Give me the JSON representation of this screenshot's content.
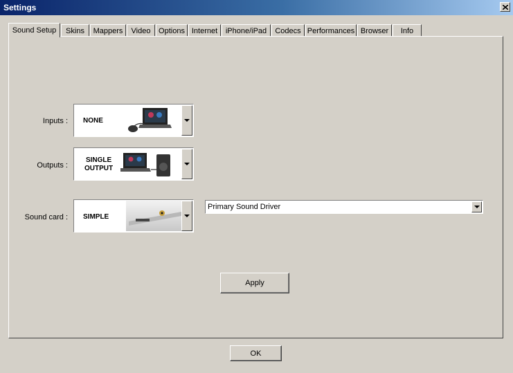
{
  "window": {
    "title": "Settings"
  },
  "tabs": [
    {
      "label": "Sound Setup",
      "active": true
    },
    {
      "label": "Skins"
    },
    {
      "label": "Mappers"
    },
    {
      "label": "Video"
    },
    {
      "label": "Options"
    },
    {
      "label": "Internet"
    },
    {
      "label": "iPhone/iPad"
    },
    {
      "label": "Codecs"
    },
    {
      "label": "Performances"
    },
    {
      "label": "Browser"
    },
    {
      "label": "Info"
    }
  ],
  "sound_setup": {
    "inputs": {
      "label": "Inputs :",
      "value": "NONE"
    },
    "outputs": {
      "label": "Outputs :",
      "value_line1": "SINGLE",
      "value_line2": "OUTPUT"
    },
    "sound_card": {
      "label": "Sound card :",
      "value": "SIMPLE",
      "driver": "Primary Sound Driver"
    },
    "apply_label": "Apply"
  },
  "footer": {
    "ok_label": "OK"
  },
  "colors": {
    "face": "#d4d0c8",
    "title_start": "#0a246a",
    "title_end": "#a6caf0"
  }
}
